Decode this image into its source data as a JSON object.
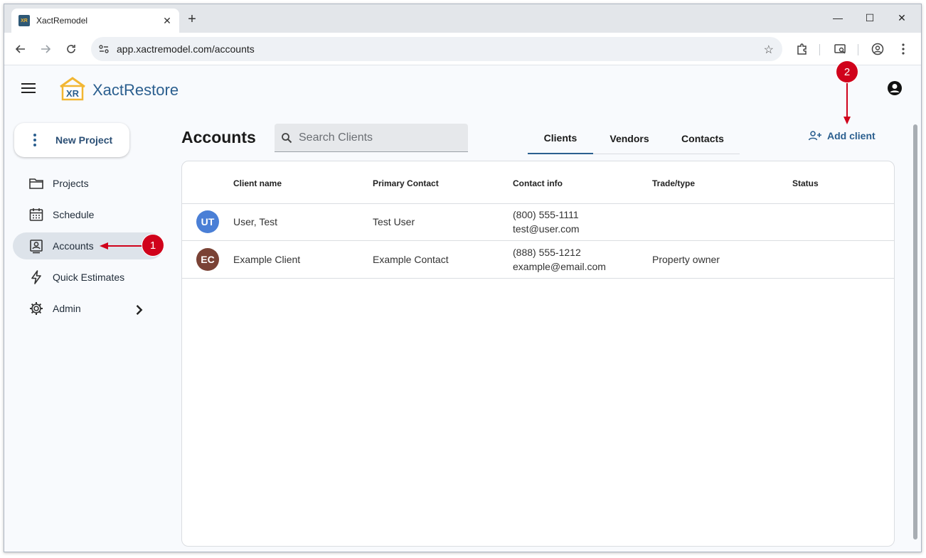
{
  "browser": {
    "tab_title": "XactRemodel",
    "favicon_text": "XR",
    "url": "app.xactremodel.com/accounts"
  },
  "app": {
    "logo_letters": "XR",
    "brand": "XactRestore",
    "new_project_label": "New Project",
    "nav": [
      {
        "label": "Projects",
        "icon": "folder-icon"
      },
      {
        "label": "Schedule",
        "icon": "calendar-icon"
      },
      {
        "label": "Accounts",
        "icon": "contact-card-icon",
        "active": true
      },
      {
        "label": "Quick Estimates",
        "icon": "lightning-icon"
      },
      {
        "label": "Admin",
        "icon": "gear-icon"
      }
    ]
  },
  "page": {
    "title": "Accounts",
    "search_placeholder": "Search Clients",
    "tabs": [
      "Clients",
      "Vendors",
      "Contacts"
    ],
    "active_tab": "Clients",
    "add_client_label": "Add client"
  },
  "table": {
    "columns": [
      "Client name",
      "Primary Contact",
      "Contact info",
      "Trade/type",
      "Status"
    ],
    "rows": [
      {
        "initials": "UT",
        "avatar_color": "#4a7fd6",
        "name": "User, Test",
        "contact": "Test User",
        "phone": "(800) 555-1111",
        "email": "test@user.com",
        "trade": "",
        "status": ""
      },
      {
        "initials": "EC",
        "avatar_color": "#7a4235",
        "name": "Example Client",
        "contact": "Example Contact",
        "phone": "(888) 555-1212",
        "email": "example@email.com",
        "trade": "Property owner",
        "status": ""
      }
    ]
  },
  "annotations": {
    "badge1": "1",
    "badge2": "2",
    "color": "#d0021b"
  }
}
